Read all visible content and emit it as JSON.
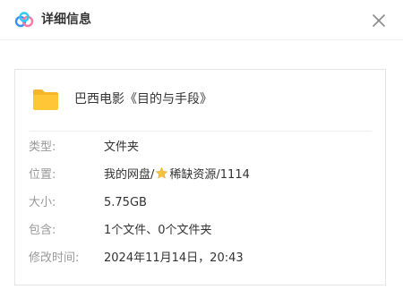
{
  "header": {
    "title": "详细信息",
    "logo_icon": "cloud-disk-logo-icon",
    "close_icon": "close-icon"
  },
  "file": {
    "icon": "folder-icon",
    "name": "巴西电影《目的与手段》"
  },
  "details": {
    "type": {
      "label": "类型:",
      "value": "文件夹"
    },
    "location": {
      "label": "位置:",
      "path_prefix": "我的网盘/",
      "star_icon": "star-icon",
      "path_suffix": "稀缺资源/1114"
    },
    "size": {
      "label": "大小:",
      "value": "5.75GB"
    },
    "contains": {
      "label": "包含:",
      "value": "1个文件、0个文件夹"
    },
    "modified": {
      "label": "修改时间:",
      "value": "2024年11月14日，20:43"
    }
  },
  "colors": {
    "folder": "#FFC737",
    "folder_back": "#F7B52C",
    "star": "#F9C23C",
    "logo_blue": "#3D8EF7",
    "logo_cyan": "#35C7F5",
    "logo_pink": "#F77BA5",
    "label_gray": "#999999",
    "text": "#333333"
  }
}
